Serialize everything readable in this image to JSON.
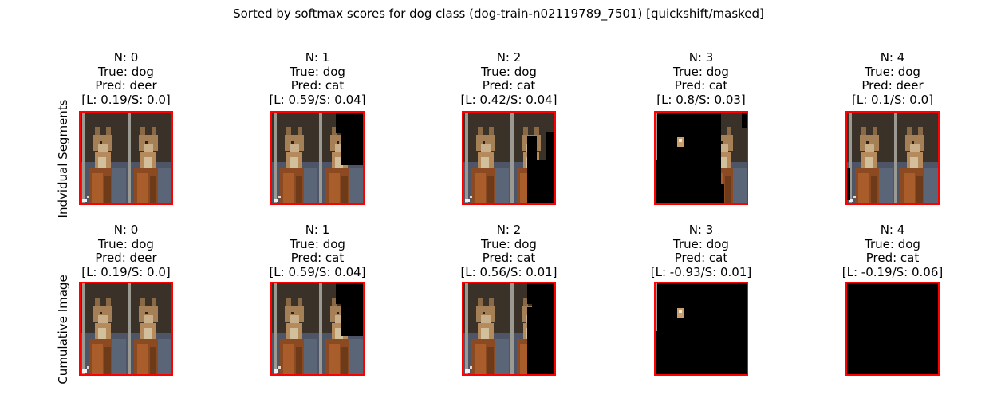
{
  "title": "Sorted by softmax scores for dog class (dog-train-n02119789_7501) [quickshift/masked]",
  "colors": {
    "frame": "#ff0000",
    "mask": "#000000"
  },
  "row_labels": [
    "Indvidual Segments",
    "Cumulative Image"
  ],
  "chart_data": {
    "type": "image-grid",
    "rows": [
      {
        "label": "Indvidual Segments",
        "panels": [
          {
            "n": "N: 0",
            "true_label": "True: dog",
            "pred": "Pred: deer",
            "score": "[L: 0.19/S: 0.0]",
            "mask": "none"
          },
          {
            "n": "N: 1",
            "true_label": "True: dog",
            "pred": "Pred: cat",
            "score": "[L: 0.59/S: 0.04]",
            "mask": "upper-right"
          },
          {
            "n": "N: 2",
            "true_label": "True: dog",
            "pred": "Pred: cat",
            "score": "[L: 0.42/S: 0.04]",
            "mask": "right"
          },
          {
            "n": "N: 3",
            "true_label": "True: dog",
            "pred": "Pred: cat",
            "score": "[L: 0.8/S: 0.03]",
            "mask": "left-with-patch"
          },
          {
            "n": "N: 4",
            "true_label": "True: dog",
            "pred": "Pred: deer",
            "score": "[L: 0.1/S: 0.0]",
            "mask": "tiny"
          }
        ]
      },
      {
        "label": "Cumulative Image",
        "panels": [
          {
            "n": "N: 0",
            "true_label": "True: dog",
            "pred": "Pred: deer",
            "score": "[L: 0.19/S: 0.0]",
            "mask": "none"
          },
          {
            "n": "N: 1",
            "true_label": "True: dog",
            "pred": "Pred: cat",
            "score": "[L: 0.59/S: 0.04]",
            "mask": "upper-right"
          },
          {
            "n": "N: 2",
            "true_label": "True: dog",
            "pred": "Pred: cat",
            "score": "[L: 0.56/S: 0.01]",
            "mask": "right-cumulative"
          },
          {
            "n": "N: 3",
            "true_label": "True: dog",
            "pred": "Pred: cat",
            "score": "[L: -0.93/S: 0.01]",
            "mask": "patch-only"
          },
          {
            "n": "N: 4",
            "true_label": "True: dog",
            "pred": "Pred: cat",
            "score": "[L: -0.19/S: 0.06]",
            "mask": "all"
          }
        ]
      }
    ]
  }
}
